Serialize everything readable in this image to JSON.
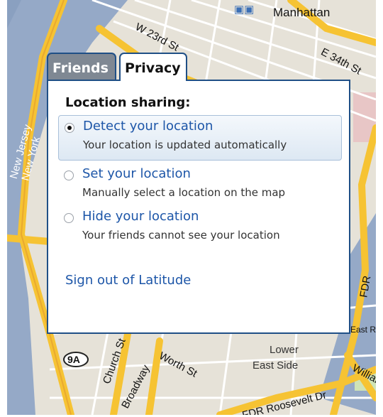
{
  "map": {
    "labels": {
      "manhattan": "Manhattan",
      "w23": "W 23rd St",
      "e34": "E 34th St",
      "new_jersey": "New Jersey",
      "new_york": "New York",
      "lower_east_side_1": "Lower",
      "lower_east_side_2": "East Side",
      "worth_st": "Worth St",
      "church_st": "Church St",
      "broadway": "Broadway",
      "roosevelt": "FDR Roosevelt Dr",
      "fdr": "FDR",
      "east_river_park": "East River Park",
      "william": "William",
      "route_9a": "9A"
    },
    "colors": {
      "water": "#95a9c7",
      "land": "#e6e2d8",
      "highway": "#f6c333",
      "road": "#ffffff"
    }
  },
  "tabs": {
    "friends": "Friends",
    "privacy": "Privacy",
    "active": "Privacy"
  },
  "panel": {
    "heading": "Location sharing:",
    "options": [
      {
        "title": "Detect your location",
        "subtitle": "Your location is updated automatically",
        "selected": true
      },
      {
        "title": "Set your location",
        "subtitle": "Manually select a  location on the map",
        "selected": false
      },
      {
        "title": "Hide your location",
        "subtitle": "Your friends cannot see your location",
        "selected": false
      }
    ],
    "signout": "Sign out of Latitude"
  }
}
